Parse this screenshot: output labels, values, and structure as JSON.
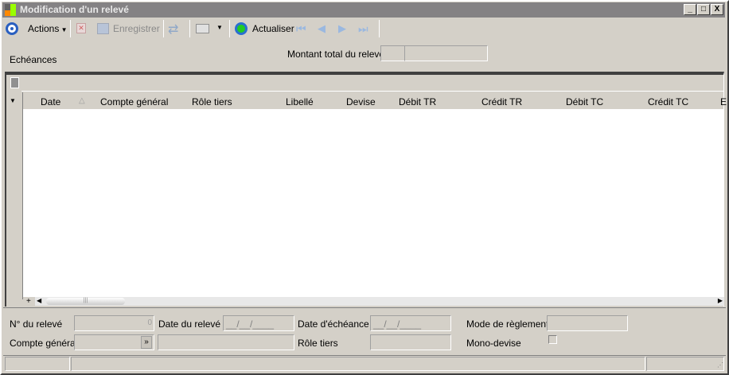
{
  "window": {
    "title": "Modification d'un relevé",
    "min": "_",
    "max": "□",
    "close": "X"
  },
  "toolbar": {
    "actions": "Actions",
    "save": "Enregistrer",
    "refresh": "Actualiser"
  },
  "header": {
    "section_label": "Echéances",
    "total_label": "Montant total du relevé"
  },
  "grid": {
    "columns": [
      "Date",
      "Compte général",
      "Rôle tiers",
      "Libellé",
      "Devise",
      "Débit TR",
      "Crédit TR",
      "Débit TC",
      "Crédit TC",
      "E"
    ],
    "add": "+"
  },
  "form": {
    "num_label": "N° du relevé",
    "num_value": "0",
    "date_label": "Date du relevé",
    "date_value": "__/__/____",
    "due_label": "Date d'échéance",
    "due_value": "__/__/____",
    "mode_label": "Mode de règlement",
    "account_label": "Compte général",
    "role_label": "Rôle tiers",
    "mono_label": "Mono-devise"
  }
}
